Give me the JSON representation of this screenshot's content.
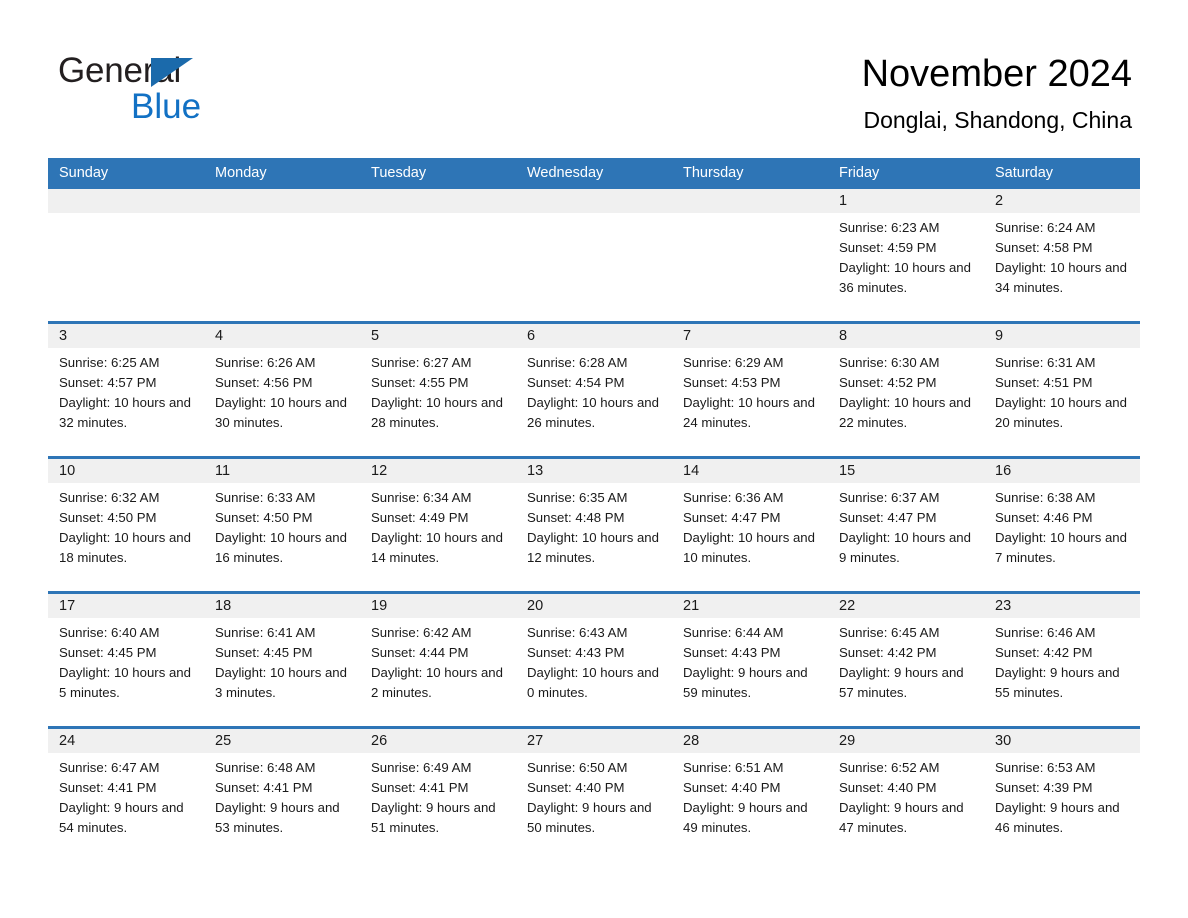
{
  "brand": {
    "line1": "General",
    "line2": "Blue",
    "mark": "triangle-logo"
  },
  "header": {
    "title": "November 2024",
    "location": "Donglai, Shandong, China"
  },
  "calendar": {
    "weekdays": [
      "Sunday",
      "Monday",
      "Tuesday",
      "Wednesday",
      "Thursday",
      "Friday",
      "Saturday"
    ],
    "colors": {
      "header_blue": "#2e75b6",
      "daynum_band": "#f0f0f0",
      "brand_blue": "#1271c4",
      "text": "#1a1a1a"
    },
    "weeks": [
      [
        {
          "day": "",
          "sunrise": "",
          "sunset": "",
          "daylight": ""
        },
        {
          "day": "",
          "sunrise": "",
          "sunset": "",
          "daylight": ""
        },
        {
          "day": "",
          "sunrise": "",
          "sunset": "",
          "daylight": ""
        },
        {
          "day": "",
          "sunrise": "",
          "sunset": "",
          "daylight": ""
        },
        {
          "day": "",
          "sunrise": "",
          "sunset": "",
          "daylight": ""
        },
        {
          "day": "1",
          "sunrise": "Sunrise: 6:23 AM",
          "sunset": "Sunset: 4:59 PM",
          "daylight": "Daylight: 10 hours and 36 minutes."
        },
        {
          "day": "2",
          "sunrise": "Sunrise: 6:24 AM",
          "sunset": "Sunset: 4:58 PM",
          "daylight": "Daylight: 10 hours and 34 minutes."
        }
      ],
      [
        {
          "day": "3",
          "sunrise": "Sunrise: 6:25 AM",
          "sunset": "Sunset: 4:57 PM",
          "daylight": "Daylight: 10 hours and 32 minutes."
        },
        {
          "day": "4",
          "sunrise": "Sunrise: 6:26 AM",
          "sunset": "Sunset: 4:56 PM",
          "daylight": "Daylight: 10 hours and 30 minutes."
        },
        {
          "day": "5",
          "sunrise": "Sunrise: 6:27 AM",
          "sunset": "Sunset: 4:55 PM",
          "daylight": "Daylight: 10 hours and 28 minutes."
        },
        {
          "day": "6",
          "sunrise": "Sunrise: 6:28 AM",
          "sunset": "Sunset: 4:54 PM",
          "daylight": "Daylight: 10 hours and 26 minutes."
        },
        {
          "day": "7",
          "sunrise": "Sunrise: 6:29 AM",
          "sunset": "Sunset: 4:53 PM",
          "daylight": "Daylight: 10 hours and 24 minutes."
        },
        {
          "day": "8",
          "sunrise": "Sunrise: 6:30 AM",
          "sunset": "Sunset: 4:52 PM",
          "daylight": "Daylight: 10 hours and 22 minutes."
        },
        {
          "day": "9",
          "sunrise": "Sunrise: 6:31 AM",
          "sunset": "Sunset: 4:51 PM",
          "daylight": "Daylight: 10 hours and 20 minutes."
        }
      ],
      [
        {
          "day": "10",
          "sunrise": "Sunrise: 6:32 AM",
          "sunset": "Sunset: 4:50 PM",
          "daylight": "Daylight: 10 hours and 18 minutes."
        },
        {
          "day": "11",
          "sunrise": "Sunrise: 6:33 AM",
          "sunset": "Sunset: 4:50 PM",
          "daylight": "Daylight: 10 hours and 16 minutes."
        },
        {
          "day": "12",
          "sunrise": "Sunrise: 6:34 AM",
          "sunset": "Sunset: 4:49 PM",
          "daylight": "Daylight: 10 hours and 14 minutes."
        },
        {
          "day": "13",
          "sunrise": "Sunrise: 6:35 AM",
          "sunset": "Sunset: 4:48 PM",
          "daylight": "Daylight: 10 hours and 12 minutes."
        },
        {
          "day": "14",
          "sunrise": "Sunrise: 6:36 AM",
          "sunset": "Sunset: 4:47 PM",
          "daylight": "Daylight: 10 hours and 10 minutes."
        },
        {
          "day": "15",
          "sunrise": "Sunrise: 6:37 AM",
          "sunset": "Sunset: 4:47 PM",
          "daylight": "Daylight: 10 hours and 9 minutes."
        },
        {
          "day": "16",
          "sunrise": "Sunrise: 6:38 AM",
          "sunset": "Sunset: 4:46 PM",
          "daylight": "Daylight: 10 hours and 7 minutes."
        }
      ],
      [
        {
          "day": "17",
          "sunrise": "Sunrise: 6:40 AM",
          "sunset": "Sunset: 4:45 PM",
          "daylight": "Daylight: 10 hours and 5 minutes."
        },
        {
          "day": "18",
          "sunrise": "Sunrise: 6:41 AM",
          "sunset": "Sunset: 4:45 PM",
          "daylight": "Daylight: 10 hours and 3 minutes."
        },
        {
          "day": "19",
          "sunrise": "Sunrise: 6:42 AM",
          "sunset": "Sunset: 4:44 PM",
          "daylight": "Daylight: 10 hours and 2 minutes."
        },
        {
          "day": "20",
          "sunrise": "Sunrise: 6:43 AM",
          "sunset": "Sunset: 4:43 PM",
          "daylight": "Daylight: 10 hours and 0 minutes."
        },
        {
          "day": "21",
          "sunrise": "Sunrise: 6:44 AM",
          "sunset": "Sunset: 4:43 PM",
          "daylight": "Daylight: 9 hours and 59 minutes."
        },
        {
          "day": "22",
          "sunrise": "Sunrise: 6:45 AM",
          "sunset": "Sunset: 4:42 PM",
          "daylight": "Daylight: 9 hours and 57 minutes."
        },
        {
          "day": "23",
          "sunrise": "Sunrise: 6:46 AM",
          "sunset": "Sunset: 4:42 PM",
          "daylight": "Daylight: 9 hours and 55 minutes."
        }
      ],
      [
        {
          "day": "24",
          "sunrise": "Sunrise: 6:47 AM",
          "sunset": "Sunset: 4:41 PM",
          "daylight": "Daylight: 9 hours and 54 minutes."
        },
        {
          "day": "25",
          "sunrise": "Sunrise: 6:48 AM",
          "sunset": "Sunset: 4:41 PM",
          "daylight": "Daylight: 9 hours and 53 minutes."
        },
        {
          "day": "26",
          "sunrise": "Sunrise: 6:49 AM",
          "sunset": "Sunset: 4:41 PM",
          "daylight": "Daylight: 9 hours and 51 minutes."
        },
        {
          "day": "27",
          "sunrise": "Sunrise: 6:50 AM",
          "sunset": "Sunset: 4:40 PM",
          "daylight": "Daylight: 9 hours and 50 minutes."
        },
        {
          "day": "28",
          "sunrise": "Sunrise: 6:51 AM",
          "sunset": "Sunset: 4:40 PM",
          "daylight": "Daylight: 9 hours and 49 minutes."
        },
        {
          "day": "29",
          "sunrise": "Sunrise: 6:52 AM",
          "sunset": "Sunset: 4:40 PM",
          "daylight": "Daylight: 9 hours and 47 minutes."
        },
        {
          "day": "30",
          "sunrise": "Sunrise: 6:53 AM",
          "sunset": "Sunset: 4:39 PM",
          "daylight": "Daylight: 9 hours and 46 minutes."
        }
      ]
    ]
  }
}
